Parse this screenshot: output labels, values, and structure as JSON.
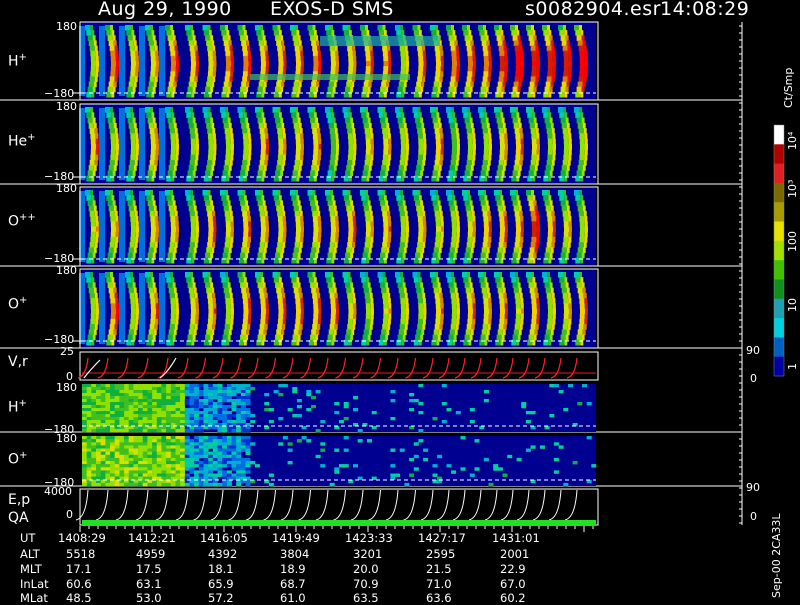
{
  "header": {
    "date": "Aug 29, 1990",
    "mission": "EXOS-D SMS",
    "file": "s0082904.esr",
    "time": "14:08:29"
  },
  "colorbar": {
    "unit": "Ct/Smp",
    "ticks": [
      "10⁴",
      "10³",
      "100",
      "10",
      "1"
    ],
    "colors": [
      "#ffffff",
      "#b00000",
      "#e02020",
      "#7a6a00",
      "#a89a00",
      "#e8e000",
      "#a0e000",
      "#40c000",
      "#109020",
      "#20a0b0",
      "#00d0e0",
      "#0060c0",
      "#0000a0"
    ]
  },
  "panels": {
    "h_plus": {
      "label": "H",
      "sup": "+",
      "ymax": "180",
      "ymin": "−180"
    },
    "he_plus": {
      "label": "He",
      "sup": "+",
      "ymax": "180",
      "ymin": "−180"
    },
    "o_plusplus": {
      "label": "O",
      "sup": "++",
      "ymax": "180",
      "ymin": "−180"
    },
    "o_plus": {
      "label": "O",
      "sup": "+",
      "ymax": "180",
      "ymin": "−180"
    },
    "vr": {
      "label": "V,r",
      "ymax": "25",
      "ymin": "0",
      "rmax": "90",
      "rmin": "0"
    },
    "h_plus_2": {
      "label": "H",
      "sup": "+",
      "ymax": "180",
      "ymin": "−180"
    },
    "o_plus_2": {
      "label": "O",
      "sup": "+",
      "ymax": "180",
      "ymin": "−180"
    },
    "ep": {
      "label": "E,p",
      "ymax": "4000",
      "ymin": "0",
      "rmax": "90",
      "rmin": "0"
    },
    "qa": {
      "label": "QA"
    }
  },
  "table": {
    "rows": [
      {
        "name": "UT",
        "values": [
          "1408:29",
          "1412:21",
          "1416:05",
          "1419:49",
          "1423:33",
          "1427:17",
          "1431:01"
        ]
      },
      {
        "name": "ALT",
        "values": [
          "5518",
          "4959",
          "4392",
          "3804",
          "3201",
          "2595",
          "2001"
        ]
      },
      {
        "name": "MLT",
        "values": [
          "17.1",
          "17.5",
          "18.1",
          "18.9",
          "20.0",
          "21.5",
          "22.9"
        ]
      },
      {
        "name": "InLat",
        "values": [
          "60.6",
          "63.1",
          "65.9",
          "68.7",
          "70.9",
          "71.0",
          "67.0"
        ]
      },
      {
        "name": "MLat",
        "values": [
          "48.5",
          "53.0",
          "57.2",
          "61.0",
          "63.5",
          "63.6",
          "60.2"
        ]
      }
    ]
  },
  "footer": {
    "code": "Sep-00 2CA33L"
  },
  "chart_data": {
    "type": "heatmap",
    "title": "Aug 29, 1990   EXOS-D SMS",
    "x_ticks": [
      "1408:29",
      "1412:21",
      "1416:05",
      "1419:49",
      "1423:33",
      "1427:17",
      "1431:01"
    ],
    "colorscale_ticks": [
      "1",
      "10",
      "100",
      "10³",
      "10⁴"
    ],
    "colorscale_unit": "Ct/Smp",
    "series": [
      {
        "name": "H+",
        "ylim": [
          -180,
          180
        ]
      },
      {
        "name": "He+",
        "ylim": [
          -180,
          180
        ]
      },
      {
        "name": "O++",
        "ylim": [
          -180,
          180
        ]
      },
      {
        "name": "O+",
        "ylim": [
          -180,
          180
        ]
      },
      {
        "name": "V,r",
        "ylim": [
          0,
          25
        ]
      },
      {
        "name": "H+",
        "ylim": [
          -180,
          180
        ]
      },
      {
        "name": "O+",
        "ylim": [
          -180,
          180
        ]
      },
      {
        "name": "E,p",
        "ylim": [
          0,
          4000
        ]
      }
    ]
  }
}
